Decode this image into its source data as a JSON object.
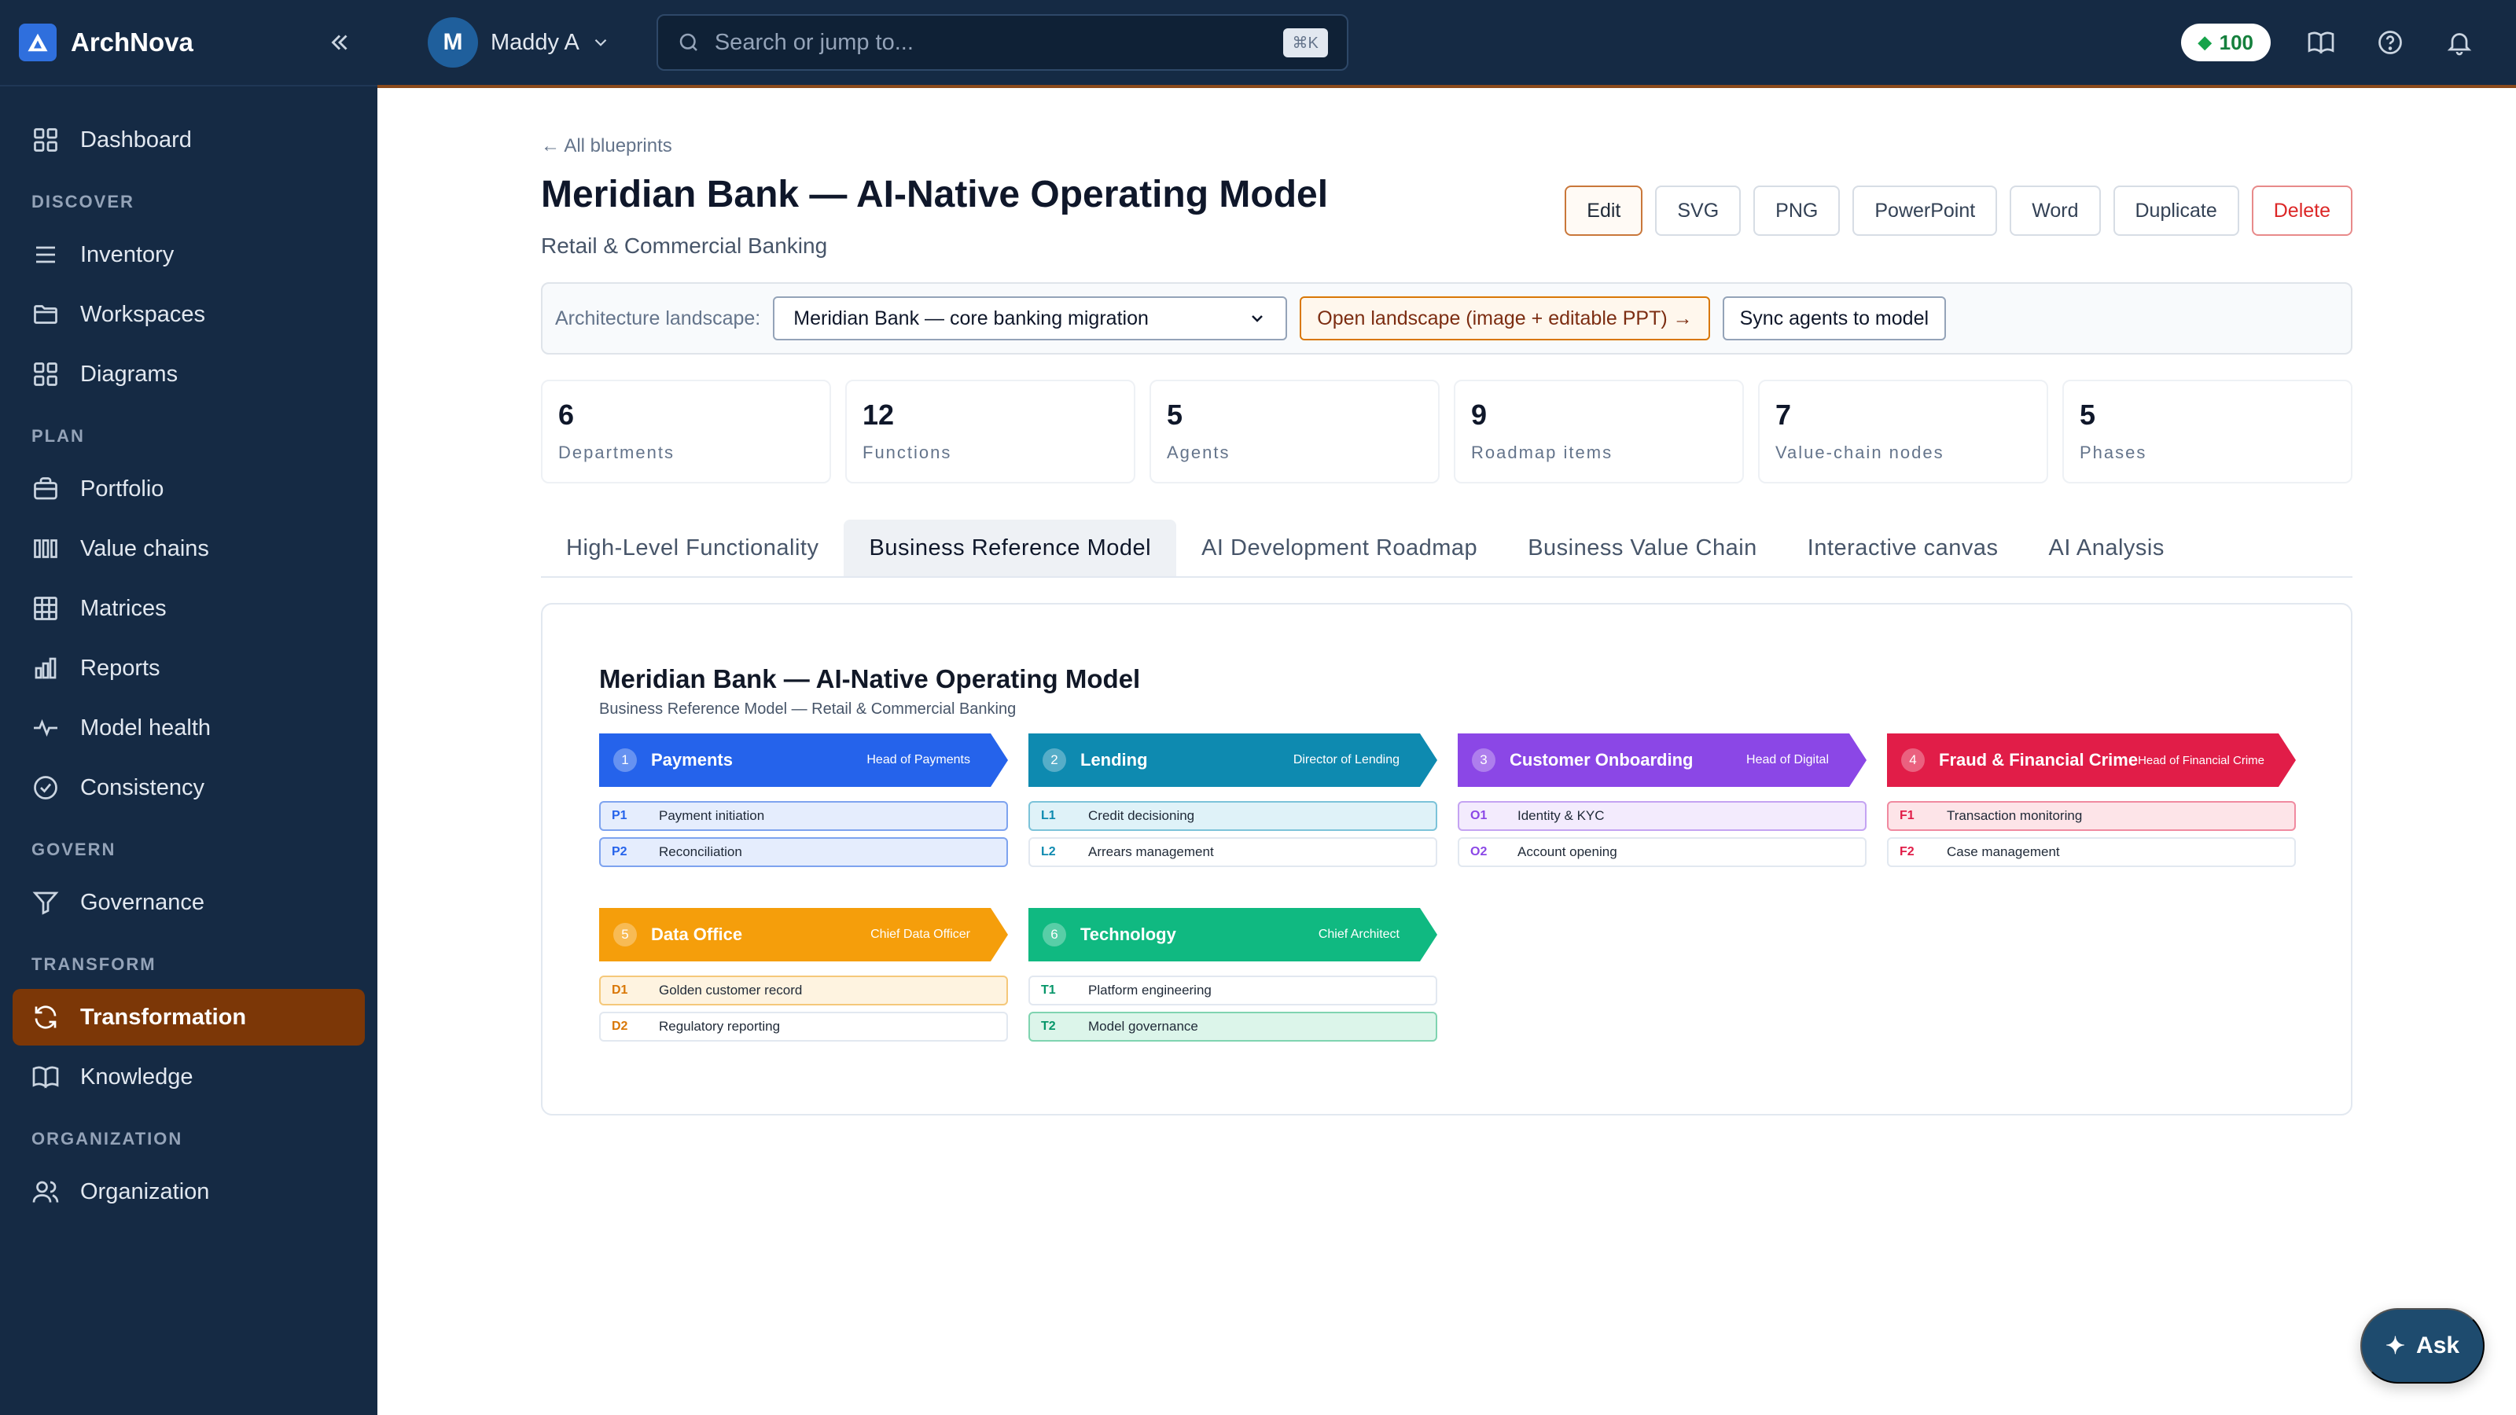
{
  "app": {
    "name": "ArchNova"
  },
  "sidebar": {
    "top": [
      {
        "label": "Dashboard",
        "icon": "grid-icon"
      }
    ],
    "sections": [
      {
        "title": "DISCOVER",
        "items": [
          {
            "label": "Inventory",
            "icon": "list-icon"
          },
          {
            "label": "Workspaces",
            "icon": "folder-icon"
          },
          {
            "label": "Diagrams",
            "icon": "grid-icon"
          }
        ]
      },
      {
        "title": "PLAN",
        "items": [
          {
            "label": "Portfolio",
            "icon": "briefcase-icon"
          },
          {
            "label": "Value chains",
            "icon": "columns-icon"
          },
          {
            "label": "Matrices",
            "icon": "table-icon"
          },
          {
            "label": "Reports",
            "icon": "bar-chart-icon"
          },
          {
            "label": "Model health",
            "icon": "pulse-icon"
          },
          {
            "label": "Consistency",
            "icon": "check-circle-icon"
          }
        ]
      },
      {
        "title": "GOVERN",
        "items": [
          {
            "label": "Governance",
            "icon": "filter-icon"
          }
        ]
      },
      {
        "title": "TRANSFORM",
        "items": [
          {
            "label": "Transformation",
            "icon": "refresh-icon",
            "active": true
          },
          {
            "label": "Knowledge",
            "icon": "book-icon"
          }
        ]
      },
      {
        "title": "ORGANIZATION",
        "items": [
          {
            "label": "Organization",
            "icon": "users-icon"
          }
        ]
      }
    ]
  },
  "topbar": {
    "avatar_initial": "M",
    "user_name": "Maddy A",
    "search_placeholder": "Search or jump to...",
    "search_shortcut": "⌘K",
    "credits": "100"
  },
  "page": {
    "back_link": "← All blueprints",
    "title": "Meridian Bank — AI-Native Operating Model",
    "subtitle": "Retail & Commercial Banking",
    "actions": {
      "edit": "Edit",
      "svg": "SVG",
      "png": "PNG",
      "powerpoint": "PowerPoint",
      "word": "Word",
      "duplicate": "Duplicate",
      "delete": "Delete"
    },
    "landscape": {
      "label": "Architecture landscape:",
      "selected": "Meridian Bank — core banking migration",
      "open_button": "Open landscape (image + editable PPT) →",
      "sync_button": "Sync agents to model"
    },
    "stats": [
      {
        "value": "6",
        "label": "Departments"
      },
      {
        "value": "12",
        "label": "Functions"
      },
      {
        "value": "5",
        "label": "Agents"
      },
      {
        "value": "9",
        "label": "Roadmap items"
      },
      {
        "value": "7",
        "label": "Value-chain nodes"
      },
      {
        "value": "5",
        "label": "Phases"
      }
    ],
    "tabs": [
      {
        "label": "High-Level Functionality"
      },
      {
        "label": "Business Reference Model",
        "active": true
      },
      {
        "label": "AI Development Roadmap"
      },
      {
        "label": "Business Value Chain"
      },
      {
        "label": "Interactive canvas"
      },
      {
        "label": "AI Analysis"
      }
    ]
  },
  "brm": {
    "title": "Meridian Bank — AI-Native Operating Model",
    "subtitle": "Business Reference Model — Retail & Commercial Banking",
    "departments": [
      {
        "num": "1",
        "name": "Payments",
        "owner": "Head of Payments",
        "color": "#2563eb",
        "tint": "#e5edfd",
        "border": "#7ea3ef",
        "code_color": "#2563eb",
        "functions": [
          {
            "code": "P1",
            "label": "Payment initiation",
            "tinted": true
          },
          {
            "code": "P2",
            "label": "Reconciliation",
            "tinted": true
          }
        ]
      },
      {
        "num": "2",
        "name": "Lending",
        "owner": "Director of Lending",
        "color": "#0e8ab0",
        "tint": "#dff2f8",
        "border": "#7cc3d9",
        "code_color": "#0e8ab0",
        "functions": [
          {
            "code": "L1",
            "label": "Credit decisioning",
            "tinted": true
          },
          {
            "code": "L2",
            "label": "Arrears management",
            "tinted": false
          }
        ]
      },
      {
        "num": "3",
        "name": "Customer Onboarding",
        "owner": "Head of Digital",
        "color": "#8b47e6",
        "tint": "#f3ebfd",
        "border": "#c4a3f2",
        "code_color": "#8b47e6",
        "functions": [
          {
            "code": "O1",
            "label": "Identity & KYC",
            "tinted": true
          },
          {
            "code": "O2",
            "label": "Account opening",
            "tinted": false
          }
        ]
      },
      {
        "num": "4",
        "name": "Fraud & Financial Crime",
        "owner": "Head of Financial Crime",
        "color": "#e11d48",
        "tint": "#fde4e8",
        "border": "#f08aa0",
        "code_color": "#e11d48",
        "functions": [
          {
            "code": "F1",
            "label": "Transaction monitoring",
            "tinted": true
          },
          {
            "code": "F2",
            "label": "Case management",
            "tinted": false
          }
        ]
      },
      {
        "num": "5",
        "name": "Data Office",
        "owner": "Chief Data Officer",
        "color": "#f59e0b",
        "tint": "#fef3e0",
        "border": "#f5c87a",
        "code_color": "#d97706",
        "functions": [
          {
            "code": "D1",
            "label": "Golden customer record",
            "tinted": true
          },
          {
            "code": "D2",
            "label": "Regulatory reporting",
            "tinted": false
          }
        ]
      },
      {
        "num": "6",
        "name": "Technology",
        "owner": "Chief Architect",
        "color": "#10b981",
        "tint": "#dcf5ea",
        "border": "#7fd4b0",
        "code_color": "#059669",
        "functions": [
          {
            "code": "T1",
            "label": "Platform engineering",
            "tinted": false
          },
          {
            "code": "T2",
            "label": "Model governance",
            "tinted": true
          }
        ]
      }
    ]
  },
  "ask_button": {
    "label": "Ask"
  }
}
